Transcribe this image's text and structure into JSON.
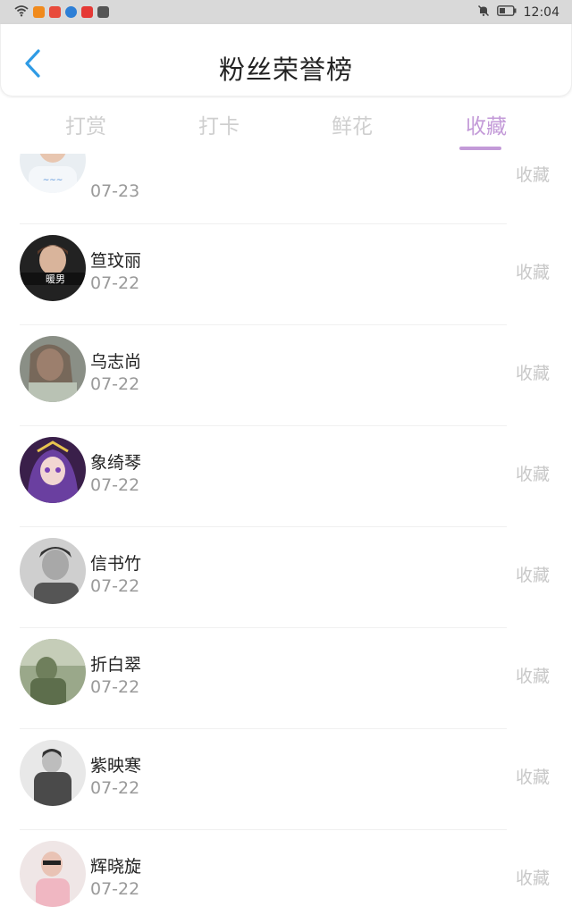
{
  "status_bar": {
    "time": "12:04",
    "icons": [
      "wifi-icon",
      "app-orange-icon",
      "app-red-icon",
      "app-blue-icon",
      "app-red-v-icon",
      "app-dark-icon",
      "mute-bell-icon",
      "battery-icon"
    ]
  },
  "header": {
    "title": "粉丝荣誉榜",
    "back_icon": "chevron-left-icon"
  },
  "tabs": [
    {
      "label": "打赏",
      "active": false
    },
    {
      "label": "打卡",
      "active": false
    },
    {
      "label": "鲜花",
      "active": false
    },
    {
      "label": "收藏",
      "active": true
    }
  ],
  "colors": {
    "accent": "#c39ad8",
    "back_icon": "#2f9be5",
    "inactive_tab": "#cfcfcf",
    "action_text": "#c8c8c8",
    "date_text": "#9a9a9a"
  },
  "list": [
    {
      "name": "",
      "date": "07-23",
      "action": "收藏",
      "avatar": "avatar-photo"
    },
    {
      "name": "笪玟丽",
      "date": "07-22",
      "action": "收藏",
      "avatar": "avatar-photo"
    },
    {
      "name": "乌志尚",
      "date": "07-22",
      "action": "收藏",
      "avatar": "avatar-photo"
    },
    {
      "name": "象绮琴",
      "date": "07-22",
      "action": "收藏",
      "avatar": "avatar-photo"
    },
    {
      "name": "信书竹",
      "date": "07-22",
      "action": "收藏",
      "avatar": "avatar-photo"
    },
    {
      "name": "折白翠",
      "date": "07-22",
      "action": "收藏",
      "avatar": "avatar-photo"
    },
    {
      "name": "紫映寒",
      "date": "07-22",
      "action": "收藏",
      "avatar": "avatar-photo"
    },
    {
      "name": "辉晓旋",
      "date": "07-22",
      "action": "收藏",
      "avatar": "avatar-photo"
    }
  ],
  "avatar_texts": {
    "row1": "暖男"
  }
}
